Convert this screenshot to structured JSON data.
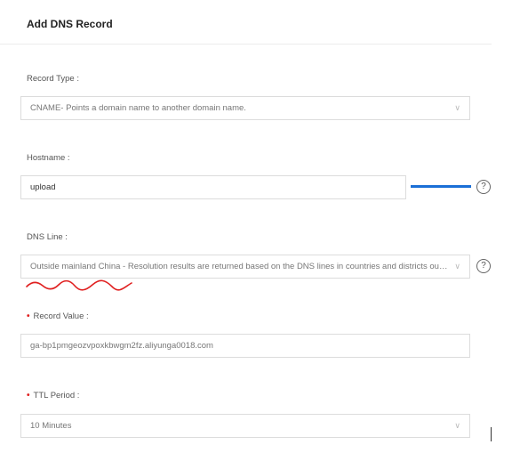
{
  "title": "Add DNS Record",
  "record_type": {
    "label": "Record Type :",
    "value": "CNAME- Points a domain name to another domain name."
  },
  "hostname": {
    "label": "Hostname :",
    "value": "upload"
  },
  "dns_line": {
    "label": "DNS Line :",
    "value": "Outside mainland China - Resolution results are returned based on the DNS lines in countries and districts outside the mainland of China."
  },
  "record_value": {
    "required_mark": "•",
    "label": "Record Value :",
    "value": "ga-bp1pmgeozvpoxkbwgm2fz.aliyunga0018.com"
  },
  "ttl": {
    "required_mark": "•",
    "label": "TTL Period :",
    "value": "10 Minutes"
  },
  "icons": {
    "help": "?",
    "chevron": "∨"
  },
  "colors": {
    "required": "#e02020",
    "annotation_blue": "#1a6fd6",
    "annotation_red": "#e02020"
  }
}
